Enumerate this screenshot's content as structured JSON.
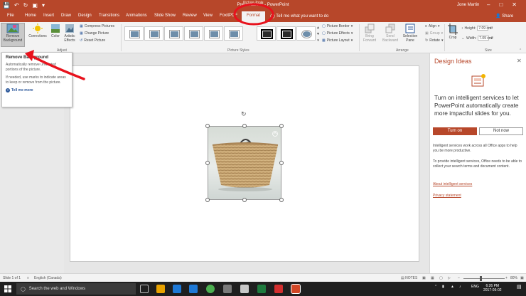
{
  "titlebar": {
    "doc_title": "Presentation1 - PowerPoint",
    "context_label": "Picture Tools",
    "user": "Jone Martin"
  },
  "tabs": {
    "items": [
      "File",
      "Home",
      "Insert",
      "Draw",
      "Design",
      "Transitions",
      "Animations",
      "Slide Show",
      "Review",
      "View",
      "FoxitPDF",
      "Format"
    ],
    "active": "Format",
    "tell_me": "Tell me what you want to do",
    "share": "Share"
  },
  "ribbon": {
    "remove_background": "Remove Background",
    "corrections": "Corrections",
    "color": "Color",
    "artistic_effects": "Artistic Effects",
    "compress": "Compress Pictures",
    "change": "Change Picture",
    "reset": "Reset Picture",
    "adjust_label": "Adjust",
    "picture_styles_label": "Picture Styles",
    "picture_border": "Picture Border",
    "picture_effects": "Picture Effects",
    "picture_layout": "Picture Layout",
    "bring_forward": "Bring Forward",
    "send_backward": "Send Backward",
    "selection_pane": "Selection Pane",
    "align": "Align",
    "group": "Group",
    "rotate": "Rotate",
    "arrange_label": "Arrange",
    "crop": "Crop",
    "height_label": "Height:",
    "height_value": "7.09 cm",
    "width_label": "Width:",
    "width_value": "7.09 cm",
    "size_label": "Size"
  },
  "tooltip": {
    "title": "Remove Background",
    "p1": "Automatically remove unwanted portions of the picture.",
    "p2": "If needed, use marks to indicate areas to keep or remove from the picture.",
    "tell_more": "Tell me more"
  },
  "design_ideas": {
    "title": "Design Ideas",
    "headline": "Turn on intelligent services to let PowerPoint automatically create more impactful slides for you.",
    "turn_on": "Turn on",
    "not_now": "Not now",
    "p1": "Intelligent services work across all Office apps to help you be more productive.",
    "p2": "To provide intelligent services, Office needs to be able to collect your search terms and document content.",
    "link1": "About intelligent services",
    "link2": "Privacy statement"
  },
  "status": {
    "slide": "Slide 1 of 1",
    "language": "English (Canada)",
    "notes": "NOTES",
    "zoom": "80%"
  },
  "taskbar": {
    "search": "Search the web and Windows",
    "lang": "ENG",
    "time": "6:26 PM",
    "date": "2017-05-02"
  },
  "colors": {
    "accent": "#b7472a",
    "annotation": "#e8121d"
  }
}
